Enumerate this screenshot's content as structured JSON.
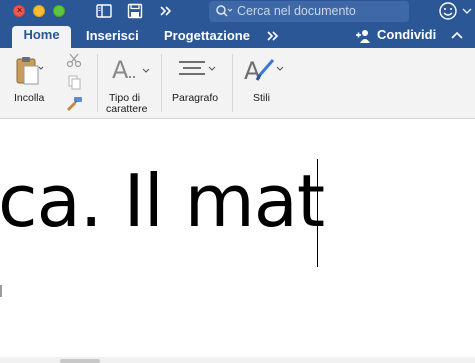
{
  "toolbar": {
    "search_placeholder": "Cerca nel documento"
  },
  "tabs": [
    {
      "label": "Home",
      "active": true
    },
    {
      "label": "Inserisci",
      "active": false
    },
    {
      "label": "Progettazione",
      "active": false
    }
  ],
  "share_label": "Condividi",
  "ribbon": {
    "paste_label": "Incolla",
    "font_label_1": "Tipo di",
    "font_label_2": "carattere",
    "paragraph_label": "Paragrafo",
    "styles_label": "Stili"
  },
  "document": {
    "visible_text": "ca. Il mat"
  },
  "colors": {
    "titlebar": "#2b5797",
    "ribbon": "#f3f3f3"
  }
}
